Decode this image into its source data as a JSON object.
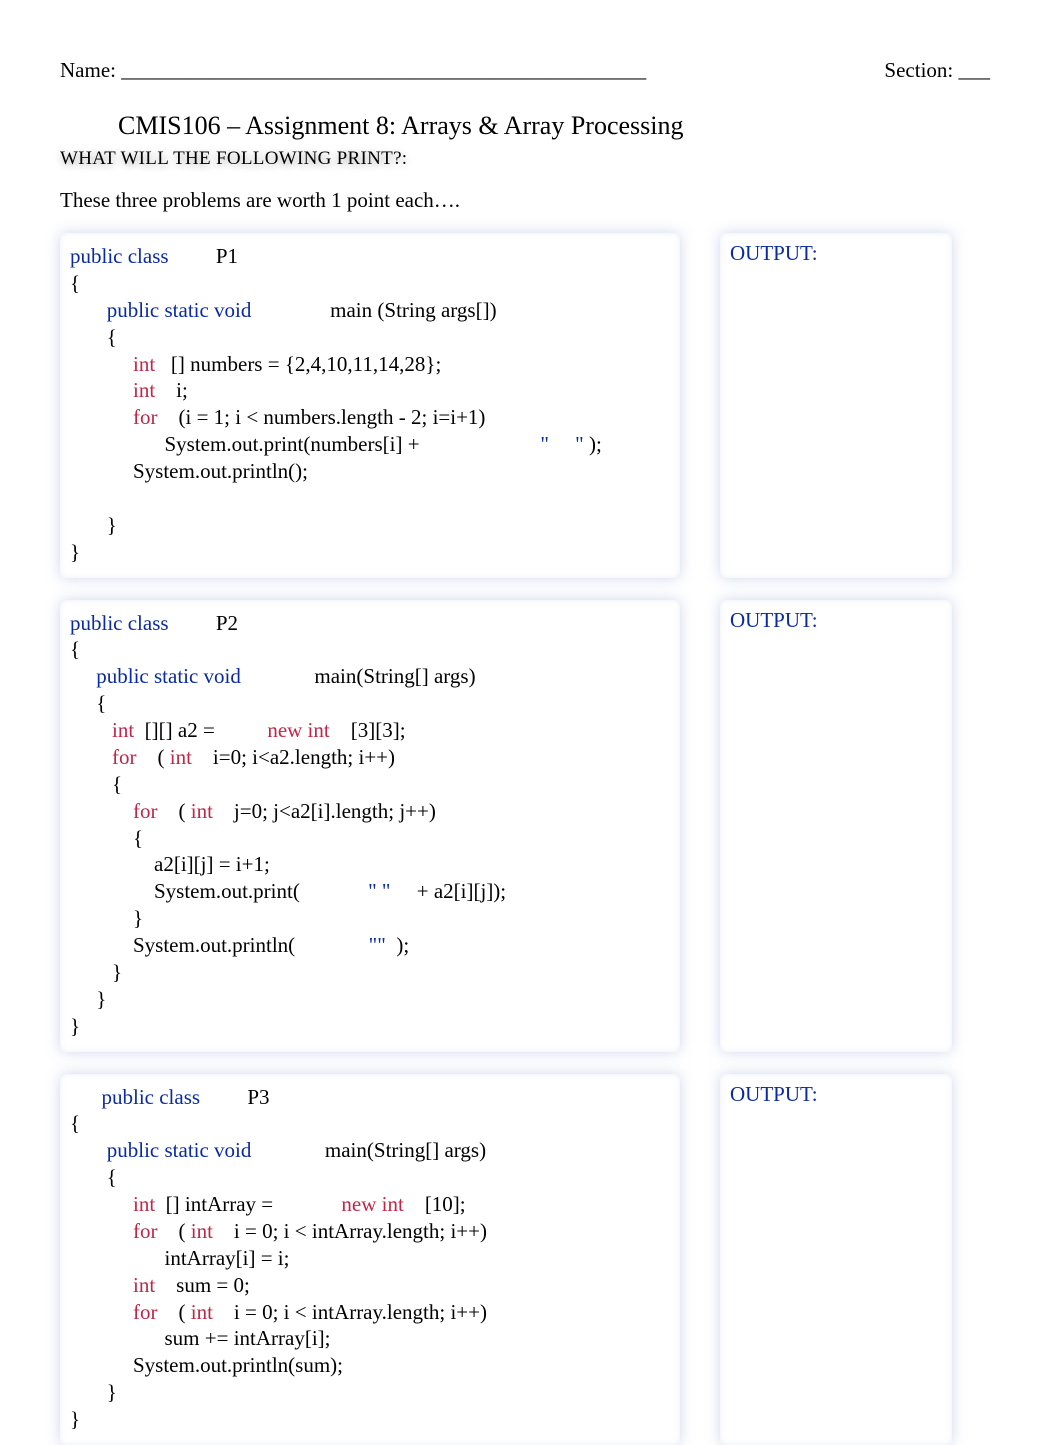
{
  "header": {
    "name_label": "Name: __________________________________________________",
    "section_label": "Section: ___"
  },
  "title": "CMIS106 – Assignment 8: Arrays & Array Processing",
  "subtitle": "WHAT WILL THE FOLLOWING PRINT?:",
  "intro": "These three problems are worth 1 point each….",
  "output_label": "OUTPUT:",
  "problems": {
    "p1": {
      "l01a": "public class",
      "l01b": "         P1",
      "l02": "{",
      "l03a": "       public static void",
      "l03b": "               main (String args[])",
      "l04": "       {",
      "l05a": "            int",
      "l05b": "   [] numbers = {2,4,10,11,14,28};",
      "l06a": "            int",
      "l06b": "    i;",
      "l07a": "            for",
      "l07b": "    (i = 1; i < numbers.length - 2; i=i+1)",
      "l08a": "                  System.out.print(numbers[i] +                       ",
      "l08b": "\"     \"",
      "l08c": " );",
      "l09": "            System.out.println();",
      "l10": "",
      "l11": "       }",
      "l12": "}"
    },
    "p2": {
      "l01a": "public class",
      "l01b": "         P2",
      "l02": "{",
      "l03a": "     public static void",
      "l03b": "              main(String[] args)",
      "l04": "     {",
      "l05a": "        int",
      "l05b": "  [][] a2 =          ",
      "l05c": "new int",
      "l05d": "    [3][3];",
      "l06a": "        for",
      "l06b": "    ( ",
      "l06c": "int",
      "l06d": "    i=0; i<a2.length; i++)",
      "l07": "        {",
      "l08a": "            for",
      "l08b": "    ( ",
      "l08c": "int",
      "l08d": "    j=0; j<a2[i].length; j++)",
      "l09": "            {",
      "l10": "                a2[i][j] = i+1;",
      "l11a": "                System.out.print(             ",
      "l11b": "\" \"",
      "l11c": "     + a2[i][j]);",
      "l12": "            }",
      "l13a": "            System.out.println(              ",
      "l13b": "\"\"",
      "l13c": "  );",
      "l14": "        }",
      "l15": "     }",
      "l16": "}"
    },
    "p3": {
      "l01a": "      public class",
      "l01b": "         P3",
      "l02": "{",
      "l03a": "       public static void",
      "l03b": "              main(String[] args)",
      "l04": "       {",
      "l05a": "            int",
      "l05b": "  [] intArray =             ",
      "l05c": "new int",
      "l05d": "    [10];",
      "l06a": "            for",
      "l06b": "    ( ",
      "l06c": "int",
      "l06d": "    i = 0; i < intArray.length; i++)",
      "l07": "                  intArray[i] = i;",
      "l08a": "            int",
      "l08b": "    sum = 0;",
      "l09a": "            for",
      "l09b": "    ( ",
      "l09c": "int",
      "l09d": "    i = 0; i < intArray.length; i++)",
      "l10": "                  sum += intArray[i];",
      "l11": "            System.out.println(sum);",
      "l12": "       }",
      "l13": "}"
    }
  }
}
